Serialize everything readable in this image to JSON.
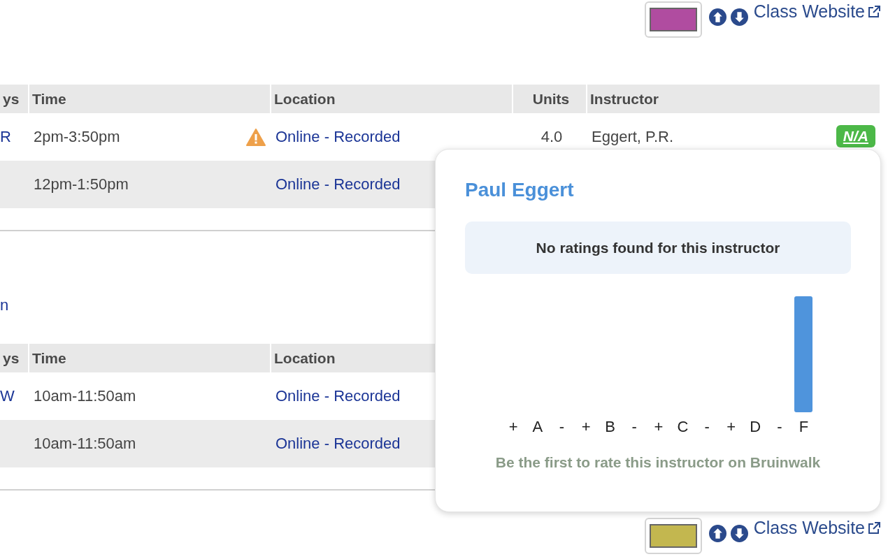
{
  "top_actions": {
    "color": "#b04ca0",
    "link": "Class Website"
  },
  "sections": [
    {
      "columns": [
        "ys",
        "Time",
        "Location",
        "Units",
        "Instructor"
      ],
      "rows": [
        {
          "days": "R",
          "time": "2pm-3:50pm",
          "warning": true,
          "location": "Online - Recorded",
          "units": "4.0",
          "instructor": "Eggert, P.R.",
          "rating": "N/A",
          "shaded": false
        },
        {
          "days": "",
          "time": "12pm-1:50pm",
          "warning": false,
          "location": "Online - Recorded",
          "shaded": true
        }
      ]
    },
    {
      "section_link": "n",
      "columns": [
        "ys",
        "Time",
        "Location"
      ],
      "rows": [
        {
          "days": "W",
          "time": "10am-11:50am",
          "warning": false,
          "location": "Online - Recorded",
          "shaded": false
        },
        {
          "days": "",
          "time": "10am-11:50am",
          "warning": false,
          "location": "Online - Recorded",
          "shaded": true
        }
      ]
    }
  ],
  "popover": {
    "title": "Paul Eggert",
    "notice": "No ratings found for this instructor",
    "bars": [
      {
        "label": "+",
        "has_bar": false
      },
      {
        "label": "A",
        "has_bar": false
      },
      {
        "label": "-",
        "has_bar": false
      },
      {
        "label": "+",
        "has_bar": false
      },
      {
        "label": "B",
        "has_bar": false
      },
      {
        "label": "-",
        "has_bar": false
      },
      {
        "label": "+",
        "has_bar": false
      },
      {
        "label": "C",
        "has_bar": false
      },
      {
        "label": "-",
        "has_bar": false
      },
      {
        "label": "+",
        "has_bar": false
      },
      {
        "label": "D",
        "has_bar": false
      },
      {
        "label": "-",
        "has_bar": false
      },
      {
        "label": "F",
        "has_bar": true
      }
    ],
    "footer": "Be the first to rate this instructor on Bruinwalk"
  },
  "bottom_actions": {
    "color": "#c3b74f",
    "link": "Class Website"
  }
}
